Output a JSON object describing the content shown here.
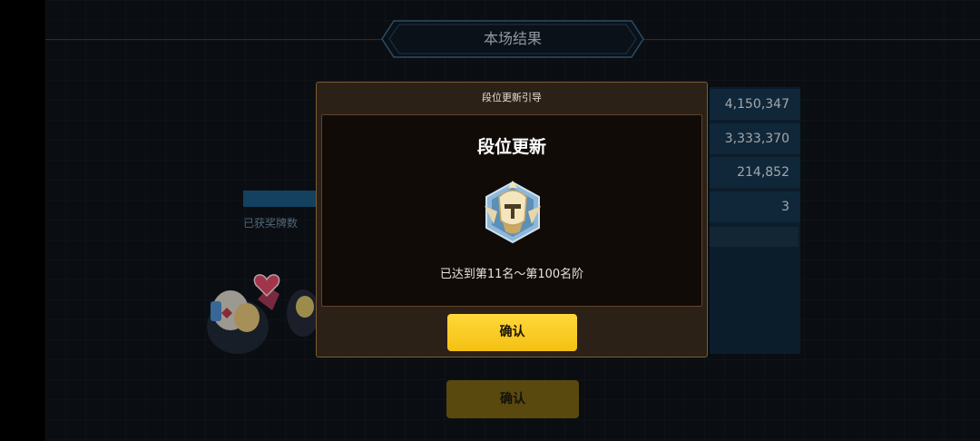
{
  "header": {
    "title": "本场结果"
  },
  "scores": [
    "4,150,347",
    "3,333,370",
    "214,852",
    "3"
  ],
  "medal": {
    "label": "已获奖牌数"
  },
  "background": {
    "confirm_label": "确认"
  },
  "modal": {
    "title": "段位更新引导",
    "heading": "段位更新",
    "rank_text": "已达到第11名～第100名阶",
    "confirm_label": "确认",
    "icon": "rank-emblem-icon"
  },
  "colors": {
    "accent_yellow": "#f9c91f",
    "panel_blue": "#163650",
    "modal_border": "#7b5c34"
  }
}
